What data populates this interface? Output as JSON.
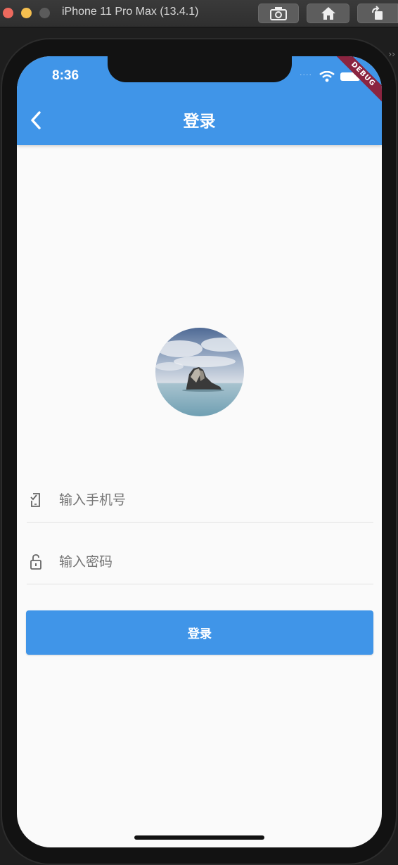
{
  "simulator": {
    "window_title": "iPhone 11 Pro Max (13.4.1)",
    "buttons": [
      "screenshot-icon",
      "home-icon",
      "rotate-icon"
    ]
  },
  "status_bar": {
    "time": "8:36",
    "debug_banner": "DEBUG"
  },
  "app_bar": {
    "title": "登录",
    "back_icon": "chevron-left-icon"
  },
  "avatar": {
    "description_icon": "island-photo-avatar"
  },
  "form": {
    "phone": {
      "icon": "phone-icon",
      "placeholder": "输入手机号",
      "value": ""
    },
    "password": {
      "icon": "lock-icon",
      "placeholder": "输入密码",
      "value": ""
    },
    "submit_label": "登录"
  },
  "colors": {
    "primary": "#4095e8",
    "background": "#fafafa",
    "debug_ribbon": "#8b2440"
  }
}
